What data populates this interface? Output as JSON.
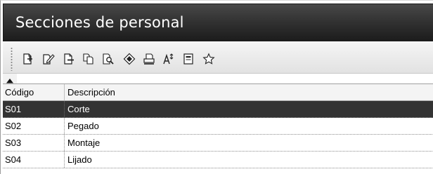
{
  "window": {
    "title": "Secciones de personal"
  },
  "toolbar": {
    "buttons": [
      {
        "icon": "new-document-icon"
      },
      {
        "icon": "edit-document-icon"
      },
      {
        "icon": "delete-document-icon"
      },
      {
        "icon": "copy-document-icon"
      },
      {
        "icon": "search-document-icon"
      },
      {
        "icon": "filter-icon"
      },
      {
        "icon": "print-icon"
      },
      {
        "icon": "sort-icon"
      },
      {
        "icon": "form-icon"
      },
      {
        "icon": "favorite-star-icon"
      }
    ]
  },
  "grid": {
    "columns": [
      "Código",
      "Descripción"
    ],
    "rows": [
      {
        "code": "S01",
        "description": "Corte",
        "selected": true
      },
      {
        "code": "S02",
        "description": "Pegado",
        "selected": false
      },
      {
        "code": "S03",
        "description": "Montaje",
        "selected": false
      },
      {
        "code": "S04",
        "description": "Lijado",
        "selected": false
      }
    ]
  },
  "colors": {
    "title_bar": "#2a2a2a",
    "selected_row": "#333333",
    "grid_line": "#8c8c8c"
  }
}
